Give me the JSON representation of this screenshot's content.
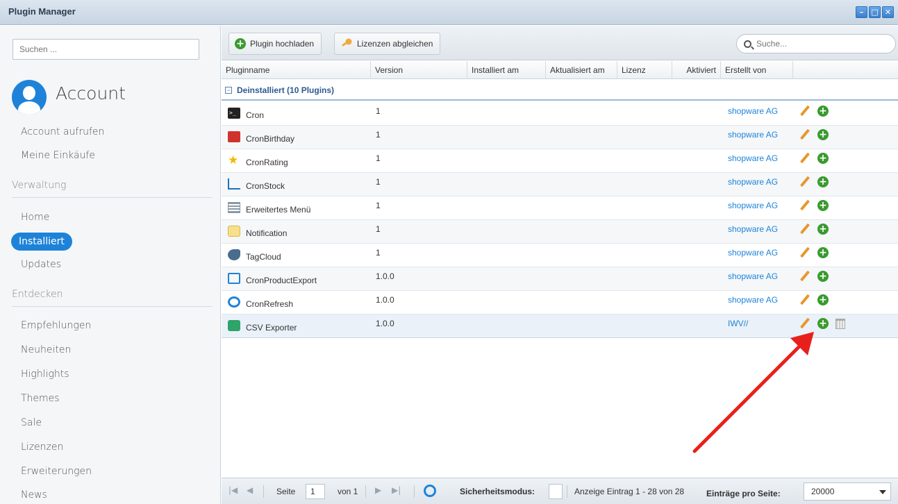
{
  "window": {
    "title": "Plugin Manager",
    "controls": [
      "minimize",
      "maximize",
      "close"
    ]
  },
  "sidebar": {
    "search_placeholder": "Suchen ...",
    "account_title": "Account",
    "account_links": [
      "Account aufrufen",
      "Meine Einkäufe"
    ],
    "section_verwaltung": "Verwaltung",
    "verwaltung_items": [
      "Home",
      "Installiert",
      "Updates"
    ],
    "active_item": "Installiert",
    "section_entdecken": "Entdecken",
    "entdecken_items": [
      "Empfehlungen",
      "Neuheiten",
      "Highlights",
      "Themes",
      "Sale",
      "Lizenzen",
      "Erweiterungen",
      "News"
    ]
  },
  "toolbar": {
    "upload_label": "Plugin hochladen",
    "licenses_label": "Lizenzen abgleichen",
    "search_placeholder": "Suche..."
  },
  "grid": {
    "columns": [
      "Pluginname",
      "Version",
      "Installiert am",
      "Aktualisiert am",
      "Lizenz",
      "Aktiviert",
      "Erstellt von"
    ],
    "group_label": "Deinstalliert (10 Plugins)",
    "rows": [
      {
        "name": "Cron",
        "version": "1",
        "author": "shopware AG",
        "icon": "terminal-icon"
      },
      {
        "name": "CronBirthday",
        "version": "1",
        "author": "shopware AG",
        "icon": "gift-icon"
      },
      {
        "name": "CronRating",
        "version": "1",
        "author": "shopware AG",
        "icon": "star-icon"
      },
      {
        "name": "CronStock",
        "version": "1",
        "author": "shopware AG",
        "icon": "chart-icon"
      },
      {
        "name": "Erweitertes Menü",
        "version": "1",
        "author": "shopware AG",
        "icon": "menu-icon"
      },
      {
        "name": "Notification",
        "version": "1",
        "author": "shopware AG",
        "icon": "note-icon"
      },
      {
        "name": "TagCloud",
        "version": "1",
        "author": "shopware AG",
        "icon": "tag-icon"
      },
      {
        "name": "CronProductExport",
        "version": "1.0.0",
        "author": "shopware AG",
        "icon": "export-icon"
      },
      {
        "name": "CronRefresh",
        "version": "1.0.0",
        "author": "shopware AG",
        "icon": "refresh-icon"
      },
      {
        "name": "CSV Exporter",
        "version": "1.0.0",
        "author": "IWV//",
        "icon": "csv-icon"
      }
    ]
  },
  "pager": {
    "page_label": "Seite",
    "page_value": "1",
    "of_label": "von 1",
    "safe_mode_label": "Sicherheitsmodus:",
    "display_info": "Anzeige Eintrag 1 - 28 von 28",
    "per_page_label": "Einträge pro Seite:",
    "per_page_value": "20000"
  },
  "colors": {
    "accent": "#1e83d8",
    "add_green": "#3b9a2f",
    "arrow_red": "#e8201c"
  }
}
